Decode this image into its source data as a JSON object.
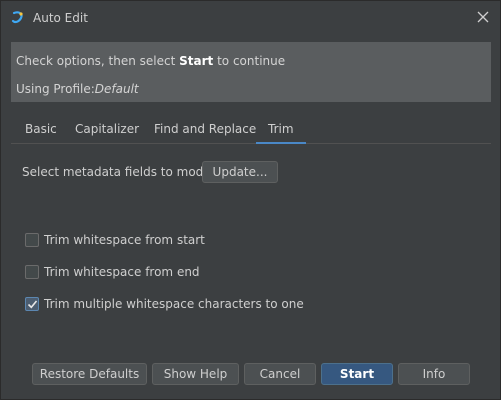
{
  "window": {
    "title": "Auto Edit"
  },
  "banner": {
    "line1_prefix": "Check options, then select ",
    "line1_bold": "Start",
    "line1_suffix": " to continue",
    "profile_label": "Using Profile:",
    "profile_name": "Default"
  },
  "tabs": [
    {
      "label": "Basic",
      "active": false
    },
    {
      "label": "Capitalizer",
      "active": false
    },
    {
      "label": "Find and Replace",
      "active": false
    },
    {
      "label": "Trim",
      "active": true
    }
  ],
  "metadata": {
    "label": "Select metadata fields to modify:",
    "update_button": "Update..."
  },
  "options": [
    {
      "label": "Trim whitespace from start",
      "checked": false
    },
    {
      "label": "Trim whitespace from end",
      "checked": false
    },
    {
      "label": "Trim multiple whitespace characters to one",
      "checked": true
    }
  ],
  "footer": {
    "restore": "Restore Defaults",
    "help": "Show Help",
    "cancel": "Cancel",
    "start": "Start",
    "info": "Info"
  },
  "colors": {
    "background": "#3c3f41",
    "banner": "#5a5d5f",
    "accent": "#4a88c7",
    "primary_button": "#365880"
  }
}
